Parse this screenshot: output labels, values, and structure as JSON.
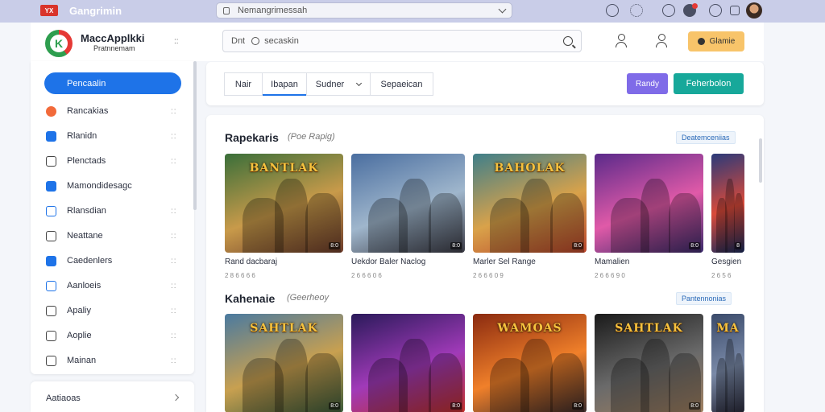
{
  "browser": {
    "logo_text": "YX",
    "title": "Gangrimin",
    "url": "Nemangrimessah"
  },
  "header": {
    "brand_initial": "K",
    "brand_name": "MaccApplkki",
    "brand_sub": "Pratnnemam",
    "brand_menu": "::",
    "search_prefix": "Dnt",
    "search_placeholder": "secaskin",
    "game_button": "Glamie"
  },
  "sidebar": {
    "primary_button": "Pencaalin",
    "items": [
      {
        "label": "Rancakias",
        "icon": "orange-badge-icon",
        "color": "#f26a3a",
        "dots": "::"
      },
      {
        "label": "Rlanidn",
        "icon": "blue-grid-icon",
        "color": "#1e73e8",
        "dots": "::"
      },
      {
        "label": "Plenctads",
        "icon": "square-icon",
        "color": "#444444",
        "dots": "::"
      },
      {
        "label": "Mamondidesagc",
        "icon": "puzzle-icon",
        "color": "#1e73e8",
        "dots": ""
      },
      {
        "label": "Rlansdian",
        "icon": "search-icon",
        "color": "#1e73e8",
        "dots": "::"
      },
      {
        "label": "Neattane",
        "icon": "list-icon",
        "color": "#444444",
        "dots": "::"
      },
      {
        "label": "Caedenlers",
        "icon": "chat-icon",
        "color": "#1e73e8",
        "dots": "::"
      },
      {
        "label": "Aanloeis",
        "icon": "phone-icon",
        "color": "#1e73e8",
        "dots": "::"
      },
      {
        "label": "Apaliy",
        "icon": "doc-icon",
        "color": "#444444",
        "dots": "::"
      },
      {
        "label": "Aoplie",
        "icon": "target-icon",
        "color": "#444444",
        "dots": "::"
      },
      {
        "label": "Mainan",
        "icon": "window-icon",
        "color": "#444444",
        "dots": "::"
      }
    ],
    "footer_label": "Aatiaoas"
  },
  "tabs": {
    "items": [
      "Nair",
      "Ibapan",
      "Sudner",
      "Sepaeican"
    ],
    "purple_button": "Randy",
    "teal_button": "Feherbolon"
  },
  "sections": [
    {
      "title": "Rapekaris",
      "subtitle": "(Poe Rapig)",
      "link": "Deatemceniias",
      "cards": [
        {
          "title_art": "BANTLAK",
          "name": "Rand dacbaraj",
          "meta": "2 8 6 6 6 6",
          "badge": "8:0"
        },
        {
          "title_art": "",
          "name": "Uekdor Baler Naclog",
          "meta": "2 6 6 6 0 6",
          "badge": "8:0"
        },
        {
          "title_art": "BAHOLAK",
          "name": "Marler Sel Range",
          "meta": "2 6 6 6 0 9",
          "badge": "8:0"
        },
        {
          "title_art": "",
          "name": "Mamalien",
          "meta": "2 6 6 6 9 0",
          "badge": "8:0"
        },
        {
          "title_art": "",
          "name": "Gesgien",
          "meta": "2 6 5 6",
          "badge": "8"
        }
      ]
    },
    {
      "title": "Kahenaie",
      "subtitle": "(Geerheoy",
      "link": "Pantennonias",
      "cards": [
        {
          "title_art": "SAHTLAK",
          "name": "",
          "meta": "",
          "badge": "8:0"
        },
        {
          "title_art": "",
          "name": "",
          "meta": "",
          "badge": "8:0"
        },
        {
          "title_art": "WAMOAS",
          "name": "",
          "meta": "",
          "badge": "8:0"
        },
        {
          "title_art": "SAHTLAK",
          "name": "",
          "meta": "",
          "badge": "8:0"
        },
        {
          "title_art": "MA",
          "name": "",
          "meta": "",
          "badge": ""
        }
      ]
    }
  ]
}
